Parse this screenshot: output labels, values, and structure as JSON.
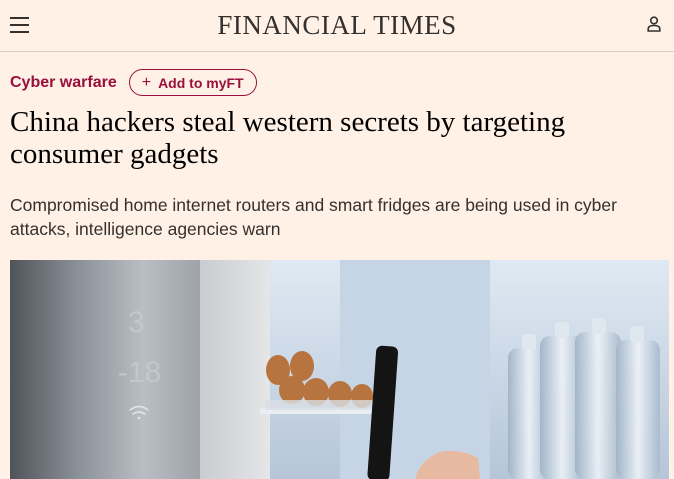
{
  "header": {
    "masthead": "FINANCIAL TIMES",
    "menu_icon": "hamburger-menu-icon",
    "account_icon": "user-account-icon"
  },
  "article": {
    "topic": "Cyber warfare",
    "myft_label": "Add to myFT",
    "headline": "China hackers steal western secrets by targeting consumer gadgets",
    "standfirst": "Compromised home internet routers and smart fridges are being used in cyber attacks, intelligence agencies warn"
  },
  "hero_image": {
    "subject": "fridge-with-hand-holding-phone",
    "fridge_display_top": "3",
    "fridge_display_bottom": "-18",
    "wifi_icon": "wifi-icon"
  },
  "colors": {
    "background": "#fff1e5",
    "accent": "#990f3d",
    "text": "#33302e"
  }
}
